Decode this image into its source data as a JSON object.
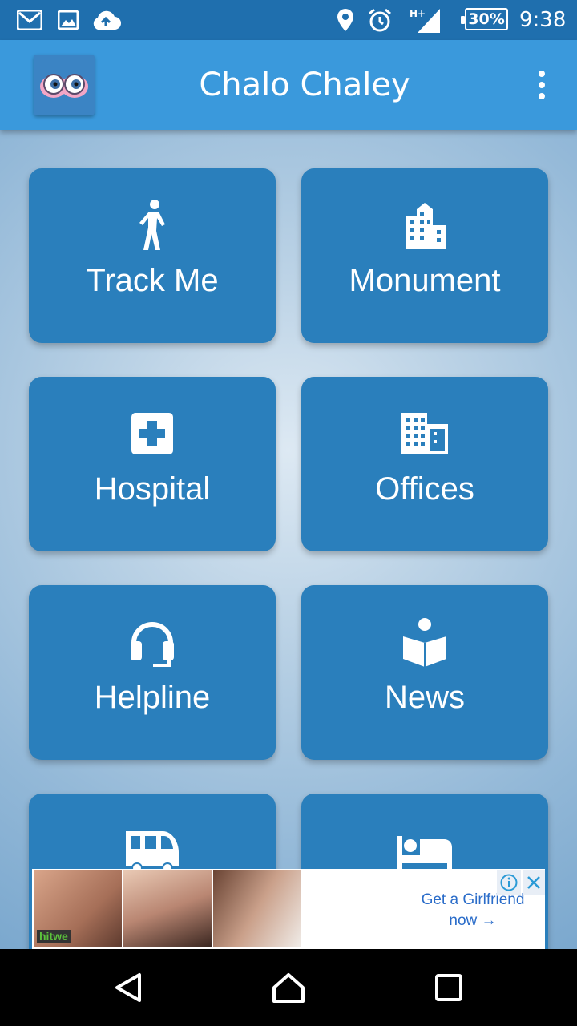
{
  "status_bar": {
    "left_icons": [
      "gmail-icon",
      "gallery-icon",
      "cloud-upload-icon"
    ],
    "right_icons": [
      "location-icon",
      "alarm-icon",
      "signal-hplus-icon"
    ],
    "network_type": "H+",
    "battery": "30%",
    "time": "9:38"
  },
  "app_bar": {
    "title": "Chalo Chaley",
    "menu_icon": "overflow-menu-icon"
  },
  "tiles": [
    {
      "label": "Track Me",
      "icon": "walking-person-icon"
    },
    {
      "label": "Monument",
      "icon": "city-building-icon"
    },
    {
      "label": "Hospital",
      "icon": "hospital-cross-icon"
    },
    {
      "label": "Offices",
      "icon": "office-building-icon"
    },
    {
      "label": "Helpline",
      "icon": "headset-icon"
    },
    {
      "label": "News",
      "icon": "reading-book-icon"
    },
    {
      "label": "",
      "icon": "bus-icon"
    },
    {
      "label": "",
      "icon": "hotel-bed-icon"
    }
  ],
  "ad": {
    "line1": "Get a Girlfriend",
    "line2": "now →",
    "brand": "hitwe"
  },
  "nav_bar": {
    "buttons": [
      "back-icon",
      "home-icon",
      "recents-icon"
    ]
  },
  "colors": {
    "status_bar": "#1f6fae",
    "app_bar": "#3a99dc",
    "tile": "#2a7fbc",
    "ad_link": "#2a6cc9"
  }
}
